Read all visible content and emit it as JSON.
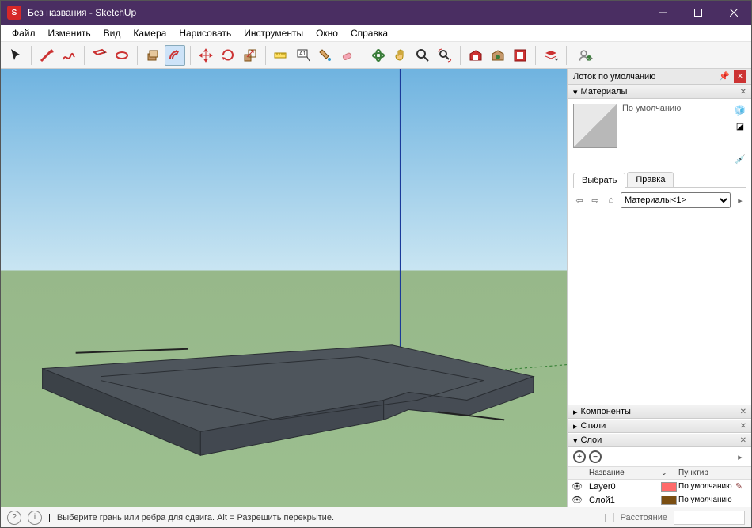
{
  "window": {
    "title": "Без названия - SketchUp"
  },
  "menu": {
    "file": "Файл",
    "edit": "Изменить",
    "view": "Вид",
    "camera": "Камера",
    "draw": "Нарисовать",
    "tools": "Инструменты",
    "window": "Окно",
    "help": "Справка"
  },
  "tray": {
    "title": "Лоток по умолчанию",
    "materials": {
      "header": "Материалы",
      "default_name": "По умолчанию",
      "tab_select": "Выбрать",
      "tab_edit": "Правка",
      "collection": "Материалы<1>"
    },
    "components": {
      "header": "Компоненты"
    },
    "styles": {
      "header": "Стили"
    },
    "layers": {
      "header": "Слои",
      "col_name": "Название",
      "col_dash": "Пунктир",
      "rows": [
        {
          "name": "Layer0",
          "color": "#ff6b6b",
          "dash": "По умолчанию"
        },
        {
          "name": "Слой1",
          "color": "#7a4e12",
          "dash": "По умолчанию"
        }
      ]
    }
  },
  "status": {
    "hint": "Выберите грань или ребра для сдвига. Alt = Разрешить перекрытие.",
    "measure_label": "Расстояние"
  },
  "toolbar_icons": [
    "select",
    "line",
    "freehand",
    "sep",
    "rectangle",
    "circle",
    "sep",
    "pushpull",
    "offset",
    "sep",
    "move",
    "rotate",
    "scale",
    "sep",
    "tape",
    "text",
    "paint",
    "eraser",
    "sep",
    "orbit",
    "pan",
    "zoom",
    "zoom-extents",
    "sep",
    "warehouse-get",
    "extension",
    "warehouse-send",
    "sep",
    "layers",
    "sep",
    "signin"
  ]
}
